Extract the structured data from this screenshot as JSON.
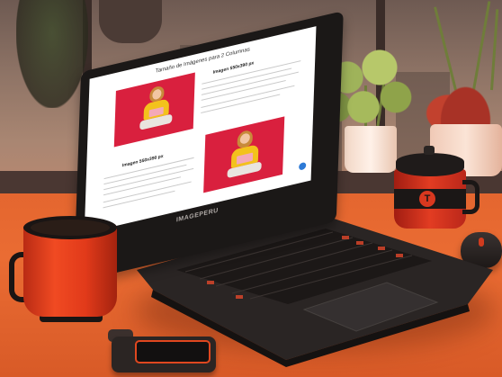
{
  "page": {
    "title": "Tamaño de Imágenes para 2 Columnas",
    "section1_heading": "Imagen 550x390 px",
    "section2_heading": "Imagen 550x390 px"
  },
  "laptop": {
    "brand": "IMAGEPERU"
  },
  "jar": {
    "logo_letter": "T"
  },
  "colors": {
    "accent_red": "#d9203e",
    "desk_orange": "#e4662f",
    "shirt_yellow": "#f3c21c"
  }
}
